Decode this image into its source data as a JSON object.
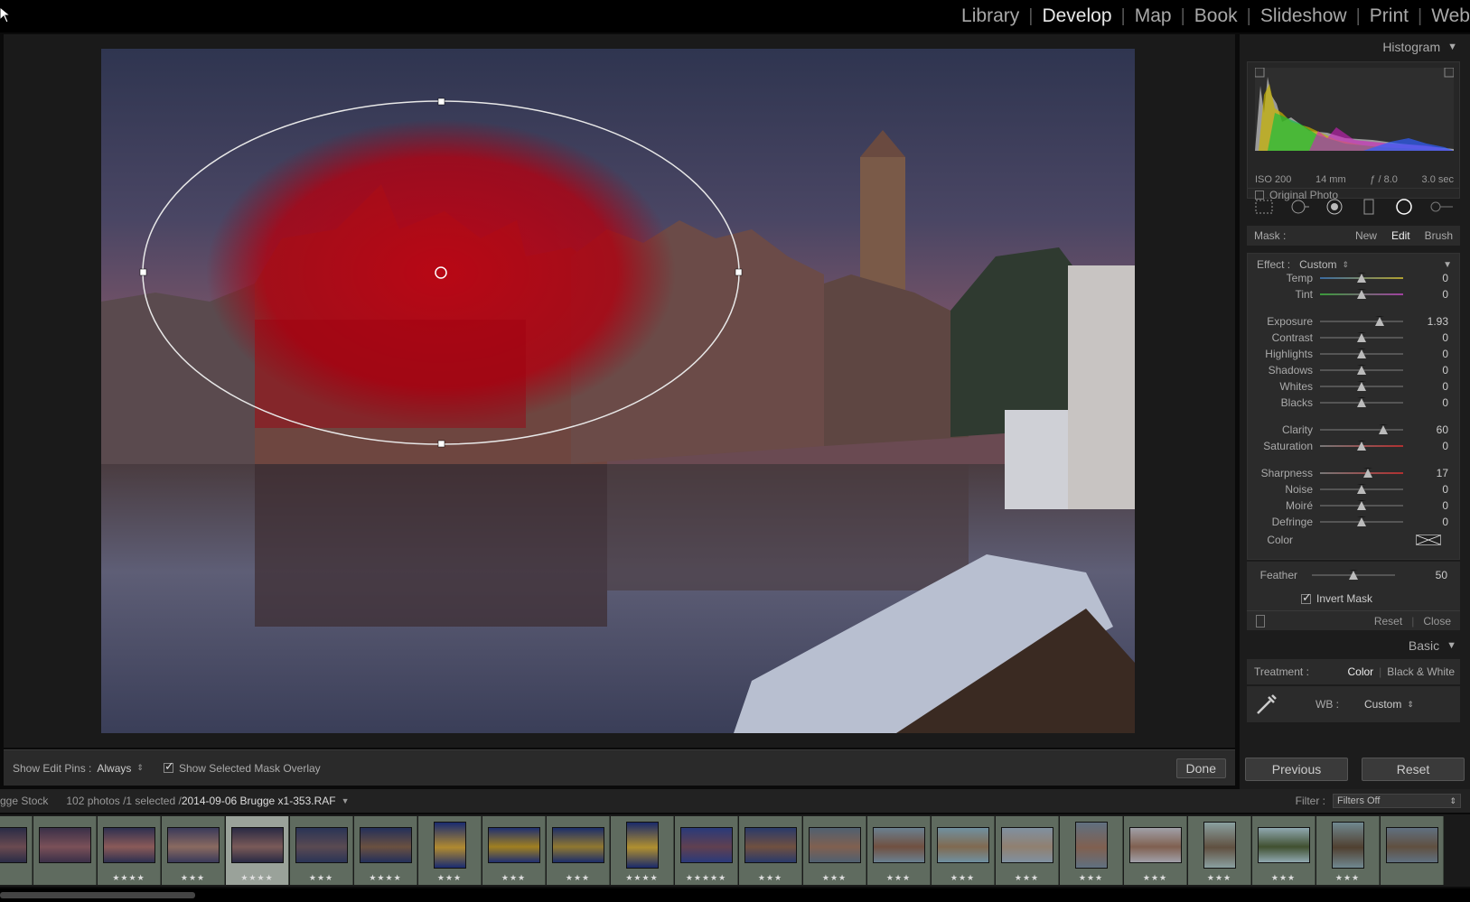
{
  "modules": [
    "Library",
    "Develop",
    "Map",
    "Book",
    "Slideshow",
    "Print",
    "Web"
  ],
  "active_module": "Develop",
  "toolbar": {
    "edit_pins_label": "Show Edit Pins :",
    "edit_pins_value": "Always",
    "mask_overlay_label": "Show Selected Mask Overlay",
    "done_label": "Done"
  },
  "histogram": {
    "title": "Histogram",
    "iso": "ISO 200",
    "focal": "14 mm",
    "aperture": "ƒ / 8.0",
    "shutter": "3.0 sec",
    "original_photo": "Original Photo"
  },
  "mask": {
    "label": "Mask :",
    "new": "New",
    "edit": "Edit",
    "brush": "Brush"
  },
  "effect": {
    "label": "Effect :",
    "value": "Custom",
    "sliders": [
      {
        "name": "Temp",
        "value": "0",
        "pos": 0.5
      },
      {
        "name": "Tint",
        "value": "0",
        "pos": 0.5
      },
      {
        "name": "Exposure",
        "value": "1.93",
        "pos": 0.72
      },
      {
        "name": "Contrast",
        "value": "0",
        "pos": 0.5
      },
      {
        "name": "Highlights",
        "value": "0",
        "pos": 0.5
      },
      {
        "name": "Shadows",
        "value": "0",
        "pos": 0.5
      },
      {
        "name": "Whites",
        "value": "0",
        "pos": 0.5
      },
      {
        "name": "Blacks",
        "value": "0",
        "pos": 0.5
      },
      {
        "name": "Clarity",
        "value": "60",
        "pos": 0.76
      },
      {
        "name": "Saturation",
        "value": "0",
        "pos": 0.5
      },
      {
        "name": "Sharpness",
        "value": "17",
        "pos": 0.58
      },
      {
        "name": "Noise",
        "value": "0",
        "pos": 0.5
      },
      {
        "name": "Moiré",
        "value": "0",
        "pos": 0.5
      },
      {
        "name": "Defringe",
        "value": "0",
        "pos": 0.5
      }
    ],
    "color_label": "Color"
  },
  "feather": {
    "name": "Feather",
    "value": "50",
    "pos": 0.5
  },
  "invert_mask": "Invert Mask",
  "reset": "Reset",
  "close": "Close",
  "basic": {
    "title": "Basic",
    "treatment_label": "Treatment :",
    "color": "Color",
    "bw": "Black & White",
    "wb_label": "WB :",
    "wb_value": "Custom"
  },
  "buttons": {
    "previous": "Previous",
    "reset": "Reset"
  },
  "filmstrip": {
    "source": "gge Stock",
    "count": "102 photos /1 selected /",
    "filename": "2014-09-06 Brugge x1-353.RAF",
    "filter_label": "Filter :",
    "filter_value": "Filters Off",
    "stars": [
      "",
      "",
      "★★★★",
      "★★★",
      "★★★★",
      "★★★",
      "★★★★",
      "★★★",
      "★★★",
      "★★★",
      "★★★★",
      "★★★★★",
      "★★★",
      "★★★",
      "★★★",
      "★★★",
      "★★★",
      "★★★",
      "★★★",
      "★★★",
      "★★★",
      "★★★",
      ""
    ]
  }
}
